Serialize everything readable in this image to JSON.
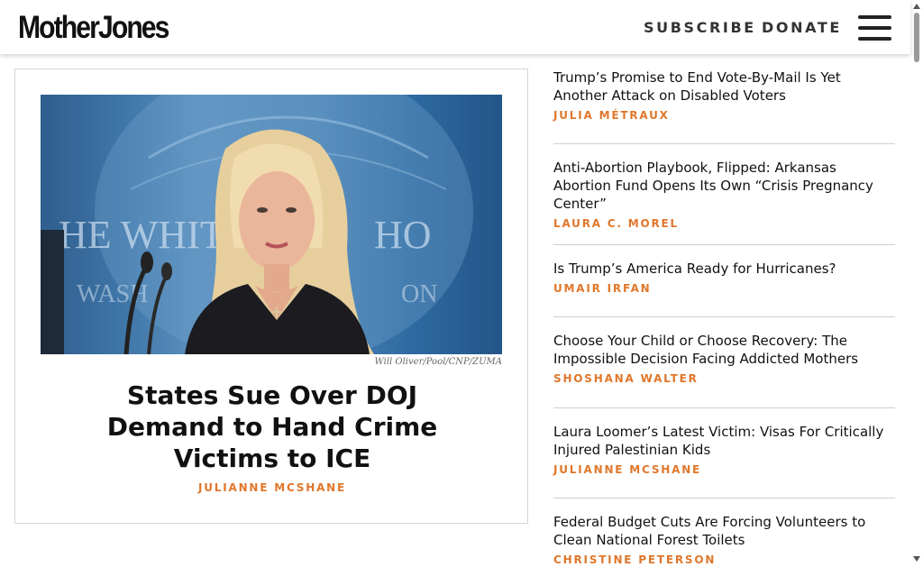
{
  "header": {
    "logo_text": "MotherJones",
    "subscribe_label": "SUBSCRIBE",
    "donate_label": "DONATE",
    "menu_icon": "hamburger-menu-icon"
  },
  "feature": {
    "photo_credit": "Will Oliver/Pool/CNP/ZUMA",
    "title": "States Sue Over DOJ Demand to Hand Crime Victims to ICE",
    "byline": "JULIANNE MCSHANE"
  },
  "side_stories": [
    {
      "title": "Trump’s Promise to End Vote-By-Mail Is Yet Another Attack on Disabled Voters",
      "byline": "JULIA MÉTRAUX"
    },
    {
      "title": "Anti-Abortion Playbook, Flipped: Arkansas Abortion Fund Opens Its Own “Crisis Pregnancy Center”",
      "byline": "LAURA C. MOREL"
    },
    {
      "title": "Is Trump’s America Ready for Hurricanes?",
      "byline": "UMAIR IRFAN"
    },
    {
      "title": "Choose Your Child or Choose Recovery: The Impossible Decision Facing Addicted Mothers",
      "byline": "SHOSHANA WALTER"
    },
    {
      "title": "Laura Loomer’s Latest Victim: Visas For Critically Injured Palestinian Kids",
      "byline": "JULIANNE MCSHANE"
    },
    {
      "title": "Federal Budget Cuts Are Forcing Volunteers to Clean National Forest Toilets",
      "byline": "CHRISTINE PETERSON"
    }
  ],
  "colors": {
    "byline_accent": "#e0772b",
    "text": "#111111",
    "divider": "#cfcfcf"
  }
}
